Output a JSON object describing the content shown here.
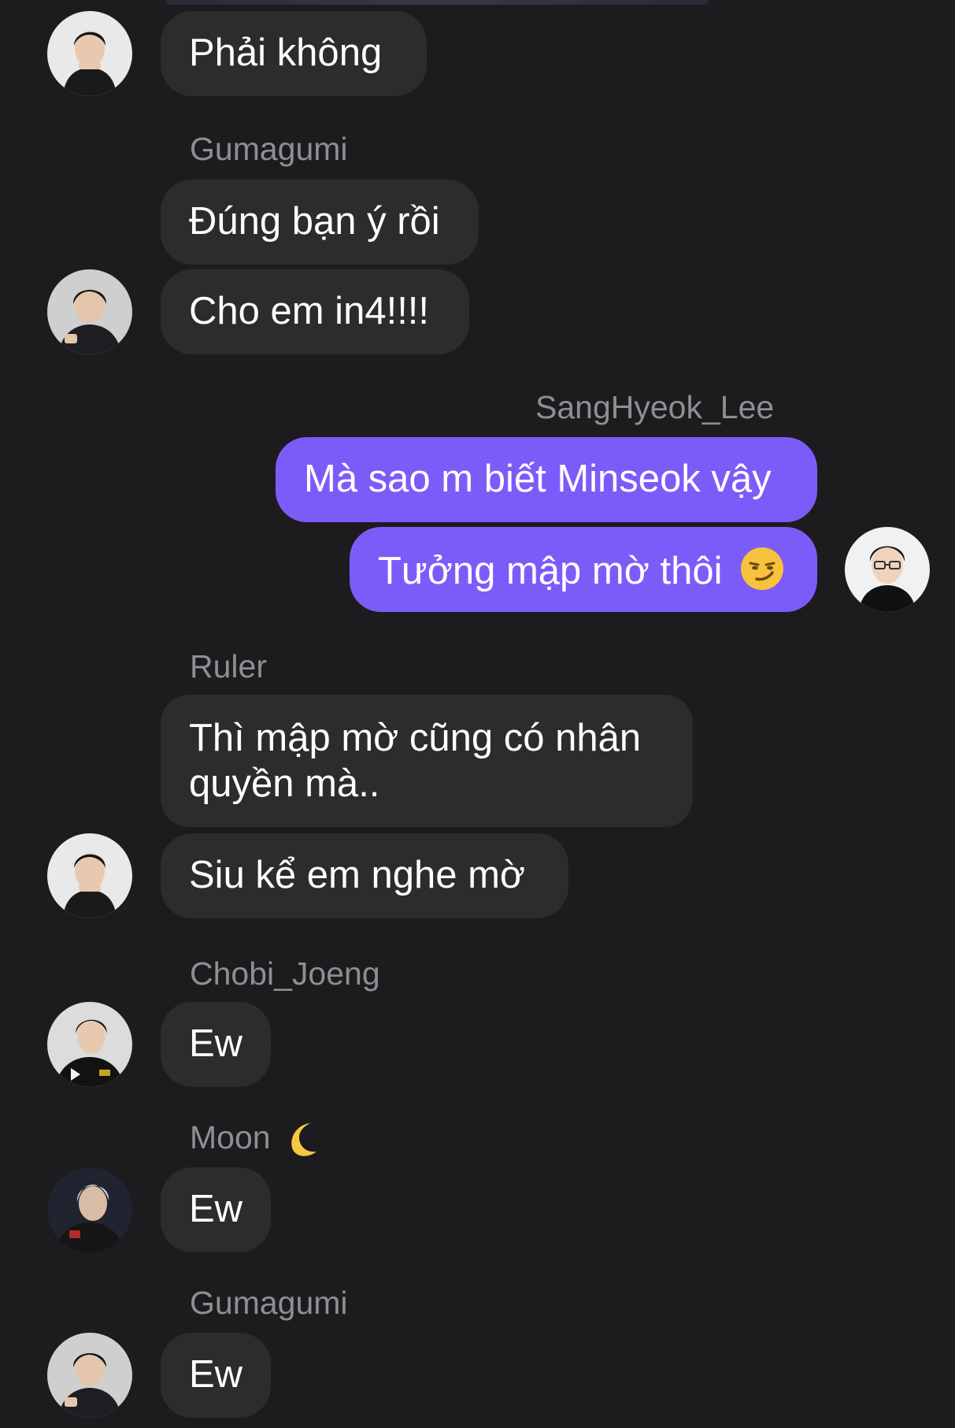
{
  "messages": [
    {
      "sender": "",
      "text": "Phải không"
    },
    {
      "sender": "Gumagumi",
      "text": "Đúng bạn ý rồi"
    },
    {
      "sender": "",
      "text": "Cho em in4!!!!"
    },
    {
      "sender": "SangHyeok_Lee",
      "text": "Mà sao m biết Minseok vậy"
    },
    {
      "sender": "",
      "text": "Tưởng mập mờ thôi",
      "emoji": "smirking-face-emoji"
    },
    {
      "sender": "Ruler",
      "text": "Thì mập mờ cũng có nhân quyền mà.."
    },
    {
      "sender": "",
      "text": "Siu kể em nghe mờ"
    },
    {
      "sender": "Chobi_Joeng",
      "text": "Ew"
    },
    {
      "sender": "Moon",
      "sender_emoji": "crescent-moon-emoji",
      "text": "Ew"
    },
    {
      "sender": "Gumagumi",
      "text": "Ew"
    },
    {
      "sender": "",
      "text": "Ew"
    }
  ],
  "colors": {
    "background": "#1c1c1e",
    "incoming_bubble": "#2c2c2e",
    "outgoing_bubble": "#7c5cf9",
    "sender_name": "#8e8e93",
    "message_text": "#ffffff"
  }
}
